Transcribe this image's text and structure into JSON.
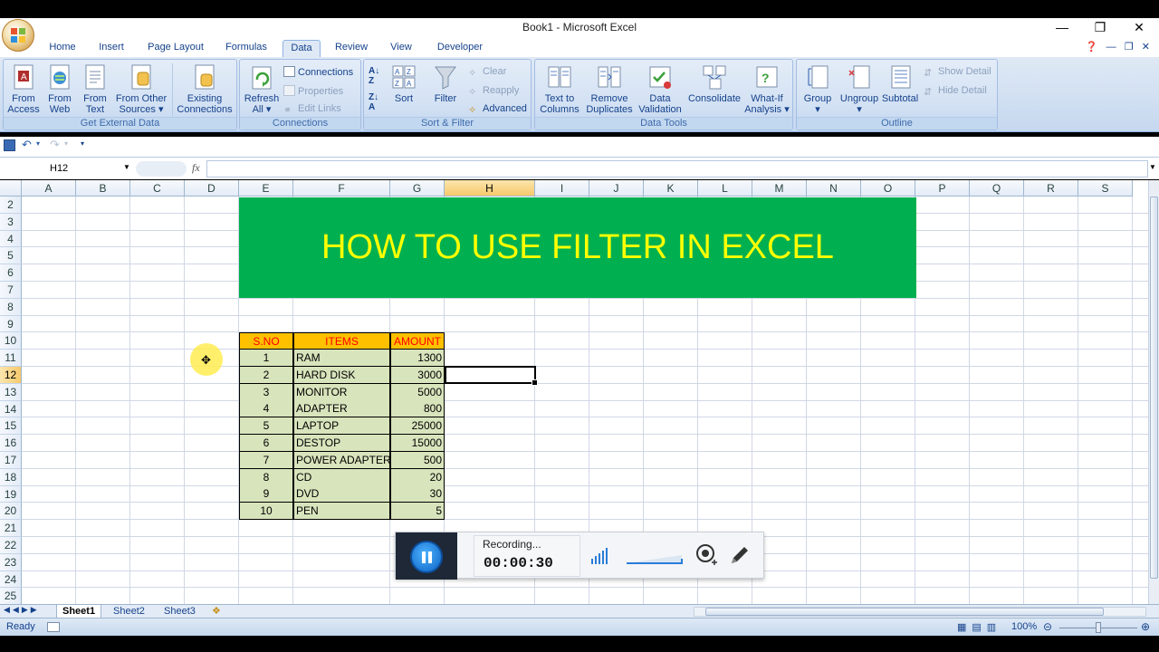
{
  "window": {
    "title": "Book1 - Microsoft Excel",
    "controls": [
      "—",
      "❐",
      "✕"
    ]
  },
  "tabs": [
    "Home",
    "Insert",
    "Page Layout",
    "Formulas",
    "Data",
    "Review",
    "View",
    "Developer"
  ],
  "active_tab": "Data",
  "ribbon": {
    "get_external_data": {
      "label": "Get External Data",
      "buttons": [
        {
          "line1": "From",
          "line2": "Access"
        },
        {
          "line1": "From",
          "line2": "Web"
        },
        {
          "line1": "From",
          "line2": "Text"
        },
        {
          "line1": "From Other",
          "line2": "Sources ▾"
        },
        {
          "line1": "Existing",
          "line2": "Connections"
        }
      ]
    },
    "connections": {
      "label": "Connections",
      "refresh": {
        "line1": "Refresh",
        "line2": "All ▾"
      },
      "connections": "Connections",
      "properties": "Properties",
      "edit_links": "Edit Links"
    },
    "sort_filter": {
      "label": "Sort & Filter",
      "sort": "Sort",
      "filter": "Filter",
      "clear": "Clear",
      "reapply": "Reapply",
      "advanced": "Advanced"
    },
    "data_tools": {
      "label": "Data Tools",
      "buttons": [
        {
          "line1": "Text to",
          "line2": "Columns"
        },
        {
          "line1": "Remove",
          "line2": "Duplicates"
        },
        {
          "line1": "Data",
          "line2": "Validation ▾"
        },
        {
          "line1": "Consolidate",
          "line2": ""
        },
        {
          "line1": "What-If",
          "line2": "Analysis ▾"
        }
      ]
    },
    "outline": {
      "label": "Outline",
      "group": {
        "line1": "Group",
        "line2": "▾"
      },
      "ungroup": {
        "line1": "Ungroup",
        "line2": "▾"
      },
      "subtotal": "Subtotal",
      "show_detail": "Show Detail",
      "hide_detail": "Hide Detail"
    }
  },
  "formula_bar": {
    "name_box": "H12",
    "fx": "fx",
    "value": ""
  },
  "columns": [
    "A",
    "B",
    "C",
    "D",
    "E",
    "F",
    "G",
    "H",
    "I",
    "J",
    "K",
    "L",
    "M",
    "N",
    "O",
    "P",
    "Q",
    "R",
    "S"
  ],
  "selected_column": "H",
  "rows": [
    "2",
    "3",
    "4",
    "5",
    "6",
    "7",
    "8",
    "9",
    "10",
    "11",
    "12",
    "13",
    "14",
    "15",
    "16",
    "17",
    "18",
    "19",
    "20",
    "21",
    "22",
    "23",
    "24",
    "25"
  ],
  "selected_row": "12",
  "banner": "HOW TO USE FILTER IN EXCEL",
  "table": {
    "headers": [
      "S.NO",
      "ITEMS",
      "AMOUNT"
    ],
    "rows": [
      {
        "sno": "1",
        "item": "RAM",
        "amount": "1300"
      },
      {
        "sno": "2",
        "item": "HARD DISK",
        "amount": "3000"
      },
      {
        "sno": "3",
        "item": "MONITOR",
        "amount": "5000"
      },
      {
        "sno": "4",
        "item": "ADAPTER",
        "amount": "800"
      },
      {
        "sno": "5",
        "item": "LAPTOP",
        "amount": "25000"
      },
      {
        "sno": "6",
        "item": "DESTOP",
        "amount": "15000"
      },
      {
        "sno": "7",
        "item": "POWER ADAPTER",
        "amount": "500"
      },
      {
        "sno": "8",
        "item": "CD",
        "amount": "20"
      },
      {
        "sno": "9",
        "item": "DVD",
        "amount": "30"
      },
      {
        "sno": "10",
        "item": "PEN",
        "amount": "5"
      }
    ]
  },
  "sheets": [
    "Sheet1",
    "Sheet2",
    "Sheet3"
  ],
  "active_sheet": "Sheet1",
  "status": {
    "ready": "Ready",
    "zoom": "100%"
  },
  "recorder": {
    "status": "Recording...",
    "time": "00:00:30"
  },
  "colors": {
    "banner_bg": "#00b050",
    "banner_text": "#ffff00",
    "header_bg": "#ffc000",
    "header_text": "#ff0000",
    "data_bg": "#d8e4bc"
  }
}
